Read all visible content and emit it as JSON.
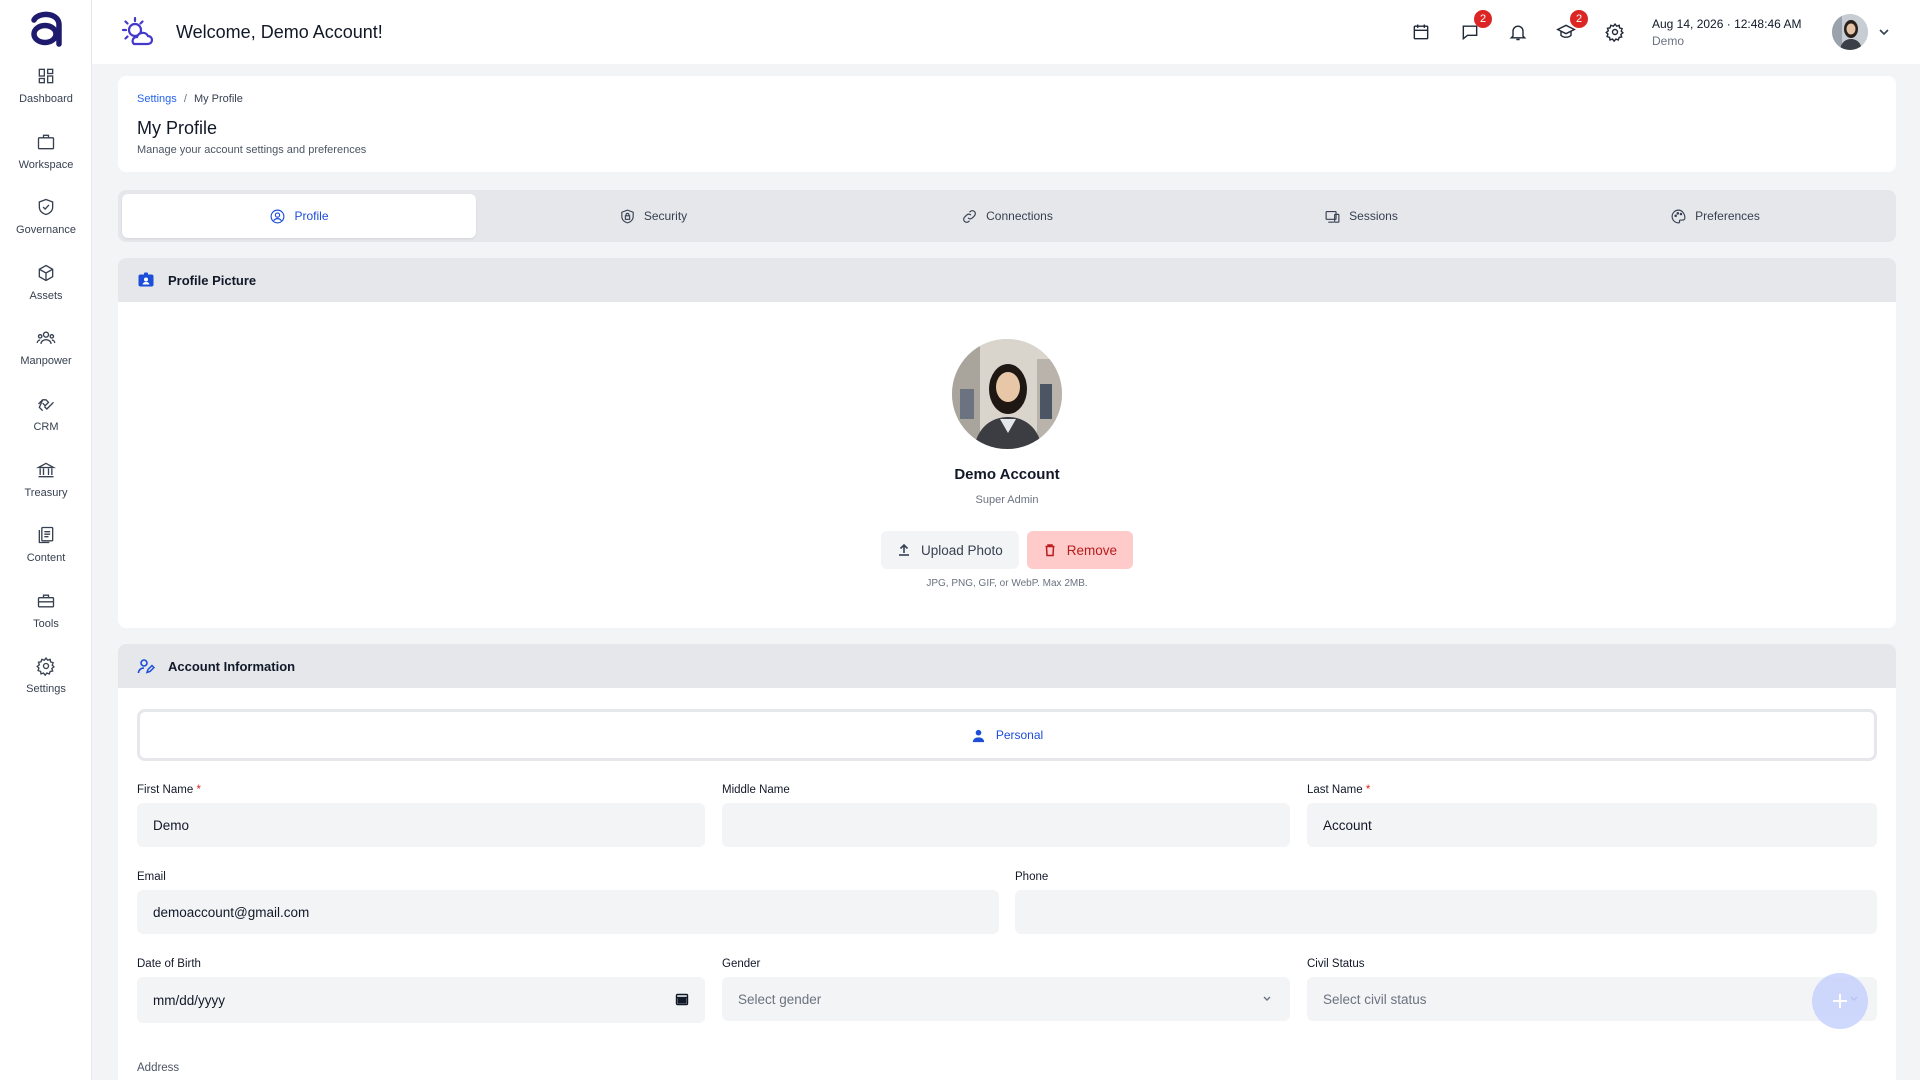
{
  "colors": {
    "accent": "#1d4ed8",
    "danger": "#dc2626",
    "remove_bg": "#fecaca",
    "panel": "#e5e7eb"
  },
  "sidebar": {
    "items": [
      {
        "label": "Dashboard",
        "icon": "dashboard-icon"
      },
      {
        "label": "Workspace",
        "icon": "briefcase-icon"
      },
      {
        "label": "Governance",
        "icon": "shield-check-icon"
      },
      {
        "label": "Assets",
        "icon": "cube-icon"
      },
      {
        "label": "Manpower",
        "icon": "users-icon"
      },
      {
        "label": "CRM",
        "icon": "handshake-icon"
      },
      {
        "label": "Treasury",
        "icon": "bank-icon"
      },
      {
        "label": "Content",
        "icon": "documents-icon"
      },
      {
        "label": "Tools",
        "icon": "toolbox-icon"
      },
      {
        "label": "Settings",
        "icon": "gear-icon"
      }
    ]
  },
  "topbar": {
    "welcome": "Welcome, Demo Account!",
    "messages_badge": "2",
    "learning_badge": "2",
    "date": "Aug 14, 2026",
    "time": "12:48:46 AM",
    "company": "Demo"
  },
  "header": {
    "breadcrumb_root": "Settings",
    "breadcrumb_sep": "/",
    "breadcrumb_current": "My Profile",
    "title": "My Profile",
    "subtitle": "Manage your account settings and preferences"
  },
  "tabs": [
    {
      "label": "Profile",
      "icon": "user-circle-icon",
      "active": true
    },
    {
      "label": "Security",
      "icon": "shield-lock-icon",
      "active": false
    },
    {
      "label": "Connections",
      "icon": "link-icon",
      "active": false
    },
    {
      "label": "Sessions",
      "icon": "devices-icon",
      "active": false
    },
    {
      "label": "Preferences",
      "icon": "palette-icon",
      "active": false
    }
  ],
  "profile_picture": {
    "section_title": "Profile Picture",
    "name": "Demo Account",
    "role": "Super Admin",
    "upload_label": "Upload Photo",
    "remove_label": "Remove",
    "hint": "JPG, PNG, GIF, or WebP. Max 2MB."
  },
  "account_info": {
    "section_title": "Account Information",
    "segment_label": "Personal",
    "fields": {
      "first_name": {
        "label": "First Name",
        "value": "Demo"
      },
      "middle_name": {
        "label": "Middle Name",
        "value": ""
      },
      "last_name": {
        "label": "Last Name",
        "value": "Account"
      },
      "email": {
        "label": "Email",
        "value": "demoaccount@gmail.com"
      },
      "phone": {
        "label": "Phone",
        "value": ""
      },
      "dob": {
        "label": "Date of Birth",
        "value": "mm/dd/yyyy"
      },
      "gender": {
        "label": "Gender",
        "placeholder": "Select gender"
      },
      "civil_status": {
        "label": "Civil Status",
        "placeholder": "Select civil status"
      },
      "address": {
        "label": "Address"
      }
    },
    "required_mark": "*"
  }
}
